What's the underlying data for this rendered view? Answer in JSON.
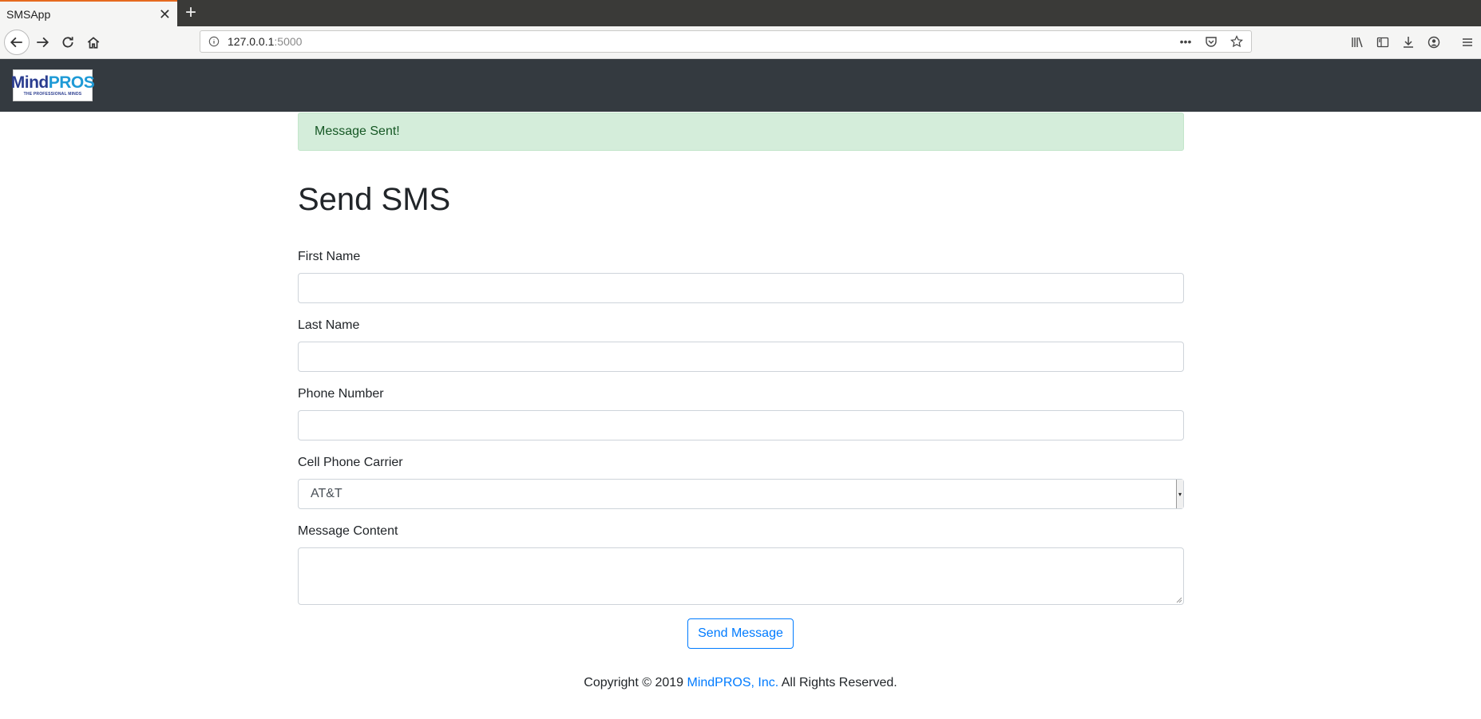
{
  "browser": {
    "tab_title": "SMSApp",
    "tab_close": "✕",
    "new_tab": "+",
    "url_host": "127.0.0.1",
    "url_port": ":5000",
    "url_actions_more": "•••"
  },
  "header": {
    "logo_mind": "Mind",
    "logo_pros": "PROS",
    "logo_tagline": "THE PROFESSIONAL MINDS"
  },
  "alert": {
    "message": "Message Sent!",
    "colors": {
      "background": "#d4edda",
      "text": "#155724"
    }
  },
  "form": {
    "title": "Send SMS",
    "first_name_label": "First Name",
    "first_name_value": "",
    "last_name_label": "Last Name",
    "last_name_value": "",
    "phone_label": "Phone Number",
    "phone_value": "",
    "carrier_label": "Cell Phone Carrier",
    "carrier_selected": "AT&T",
    "message_label": "Message Content",
    "message_value": "",
    "submit_label": "Send Message"
  },
  "footer": {
    "prefix": "Copyright © 2019 ",
    "link_text": "MindPROS, Inc.",
    "suffix": " All Rights Reserved."
  },
  "colors": {
    "header_bg": "#343a40",
    "primary": "#007bff"
  }
}
